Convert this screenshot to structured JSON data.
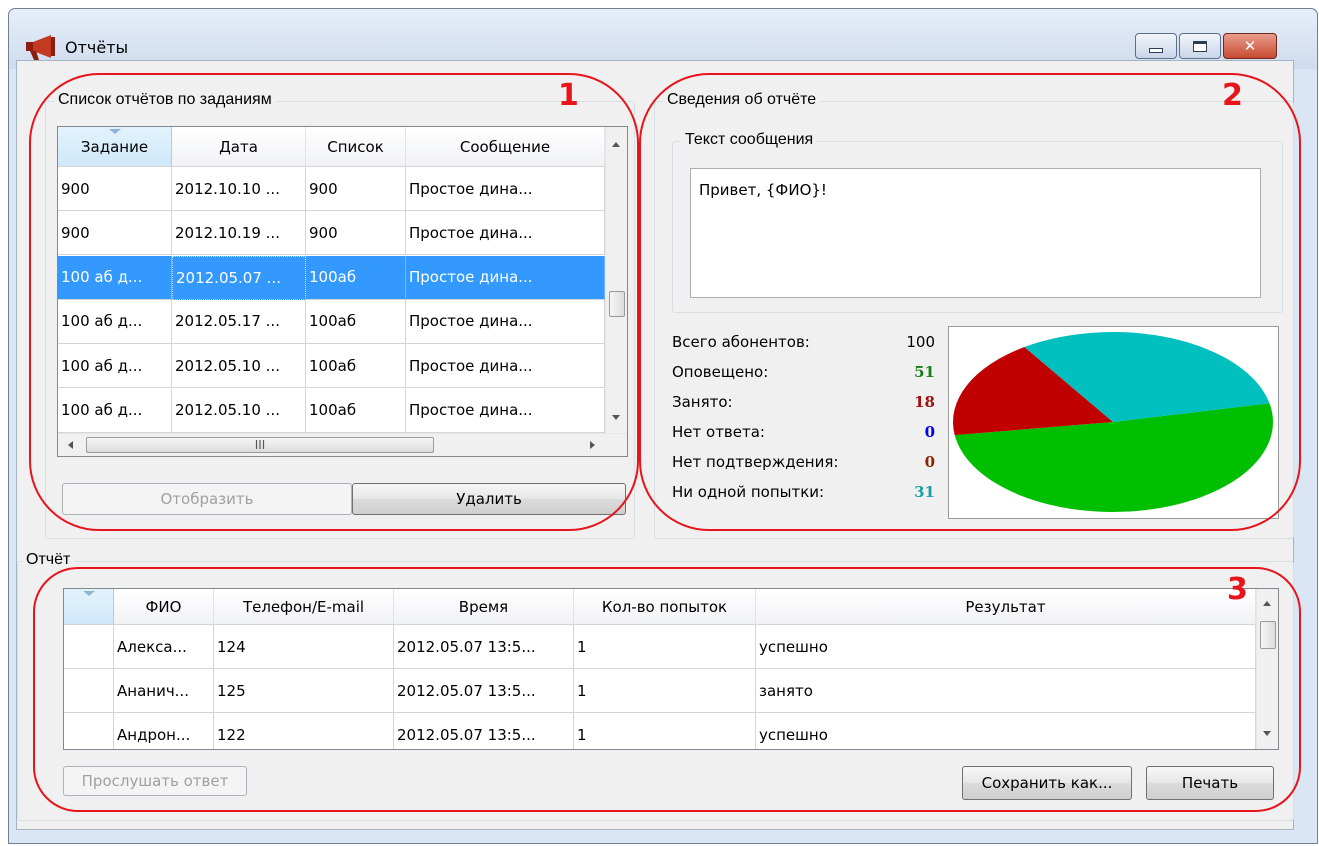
{
  "window": {
    "title": "Отчёты",
    "minimize_icon": "minimize-icon",
    "maximize_icon": "maximize-icon",
    "close_icon": "close-icon",
    "close_glyph": "✕"
  },
  "tasks_group": {
    "title": "Список отчётов по заданиям",
    "columns": [
      "Задание",
      "Дата",
      "Список",
      "Сообщение"
    ],
    "rows": [
      [
        "900",
        "2012.10.10 ...",
        "900",
        "Простое дина..."
      ],
      [
        "900",
        "2012.10.19 ...",
        "900",
        "Простое дина..."
      ],
      [
        "100 аб д...",
        "2012.05.07 ...",
        "100аб",
        "Простое дина..."
      ],
      [
        "100 аб д...",
        "2012.05.17 ...",
        "100аб",
        "Простое дина..."
      ],
      [
        "100 аб д...",
        "2012.05.10 ...",
        "100аб",
        "Простое дина..."
      ],
      [
        "100 аб д...",
        "2012.05.10 ...",
        "100аб",
        "Простое дина..."
      ]
    ],
    "selected_row": 2,
    "hscroll_grip": "III",
    "show_button": "Отобразить",
    "delete_button": "Удалить"
  },
  "details_group": {
    "title": "Сведения об отчёте",
    "message_group_title": "Текст сообщения",
    "message_text": "Привет, {ФИО}!",
    "stats": [
      {
        "label": "Всего абонентов:",
        "value": "100",
        "color": "#000000"
      },
      {
        "label": "Оповещено:",
        "value": "51",
        "color": "#1a7f1a"
      },
      {
        "label": "Занято:",
        "value": "18",
        "color": "#a01010"
      },
      {
        "label": "Нет ответа:",
        "value": "0",
        "color": "#0000ee"
      },
      {
        "label": "Нет подтверждения:",
        "value": "0",
        "color": "#8b2500"
      },
      {
        "label": "Ни одной попытки:",
        "value": "31",
        "color": "#1aa0a0"
      }
    ],
    "pie": {
      "slices": [
        {
          "name": "Оповещено",
          "value": 51,
          "color": "#00bf00"
        },
        {
          "name": "Занято",
          "value": 18,
          "color": "#c00000"
        },
        {
          "name": "Ни одной попытки",
          "value": 31,
          "color": "#00bfbf"
        }
      ]
    }
  },
  "report_group": {
    "title": "Отчёт",
    "columns": [
      "",
      "ФИО",
      "Телефон/E-mail",
      "Время",
      "Кол-во попыток",
      "Результат"
    ],
    "rows": [
      [
        "",
        "Алекса...",
        "124",
        "2012.05.07 13:5...",
        "1",
        "успешно"
      ],
      [
        "",
        "Ананич...",
        "125",
        "2012.05.07 13:5...",
        "1",
        "занято"
      ],
      [
        "",
        "Андрон...",
        "122",
        "2012.05.07 13:5...",
        "1",
        "успешно"
      ]
    ],
    "listen_button": "Прослушать ответ",
    "save_button": "Сохранить как...",
    "print_button": "Печать"
  },
  "callouts": [
    "1",
    "2",
    "3"
  ]
}
